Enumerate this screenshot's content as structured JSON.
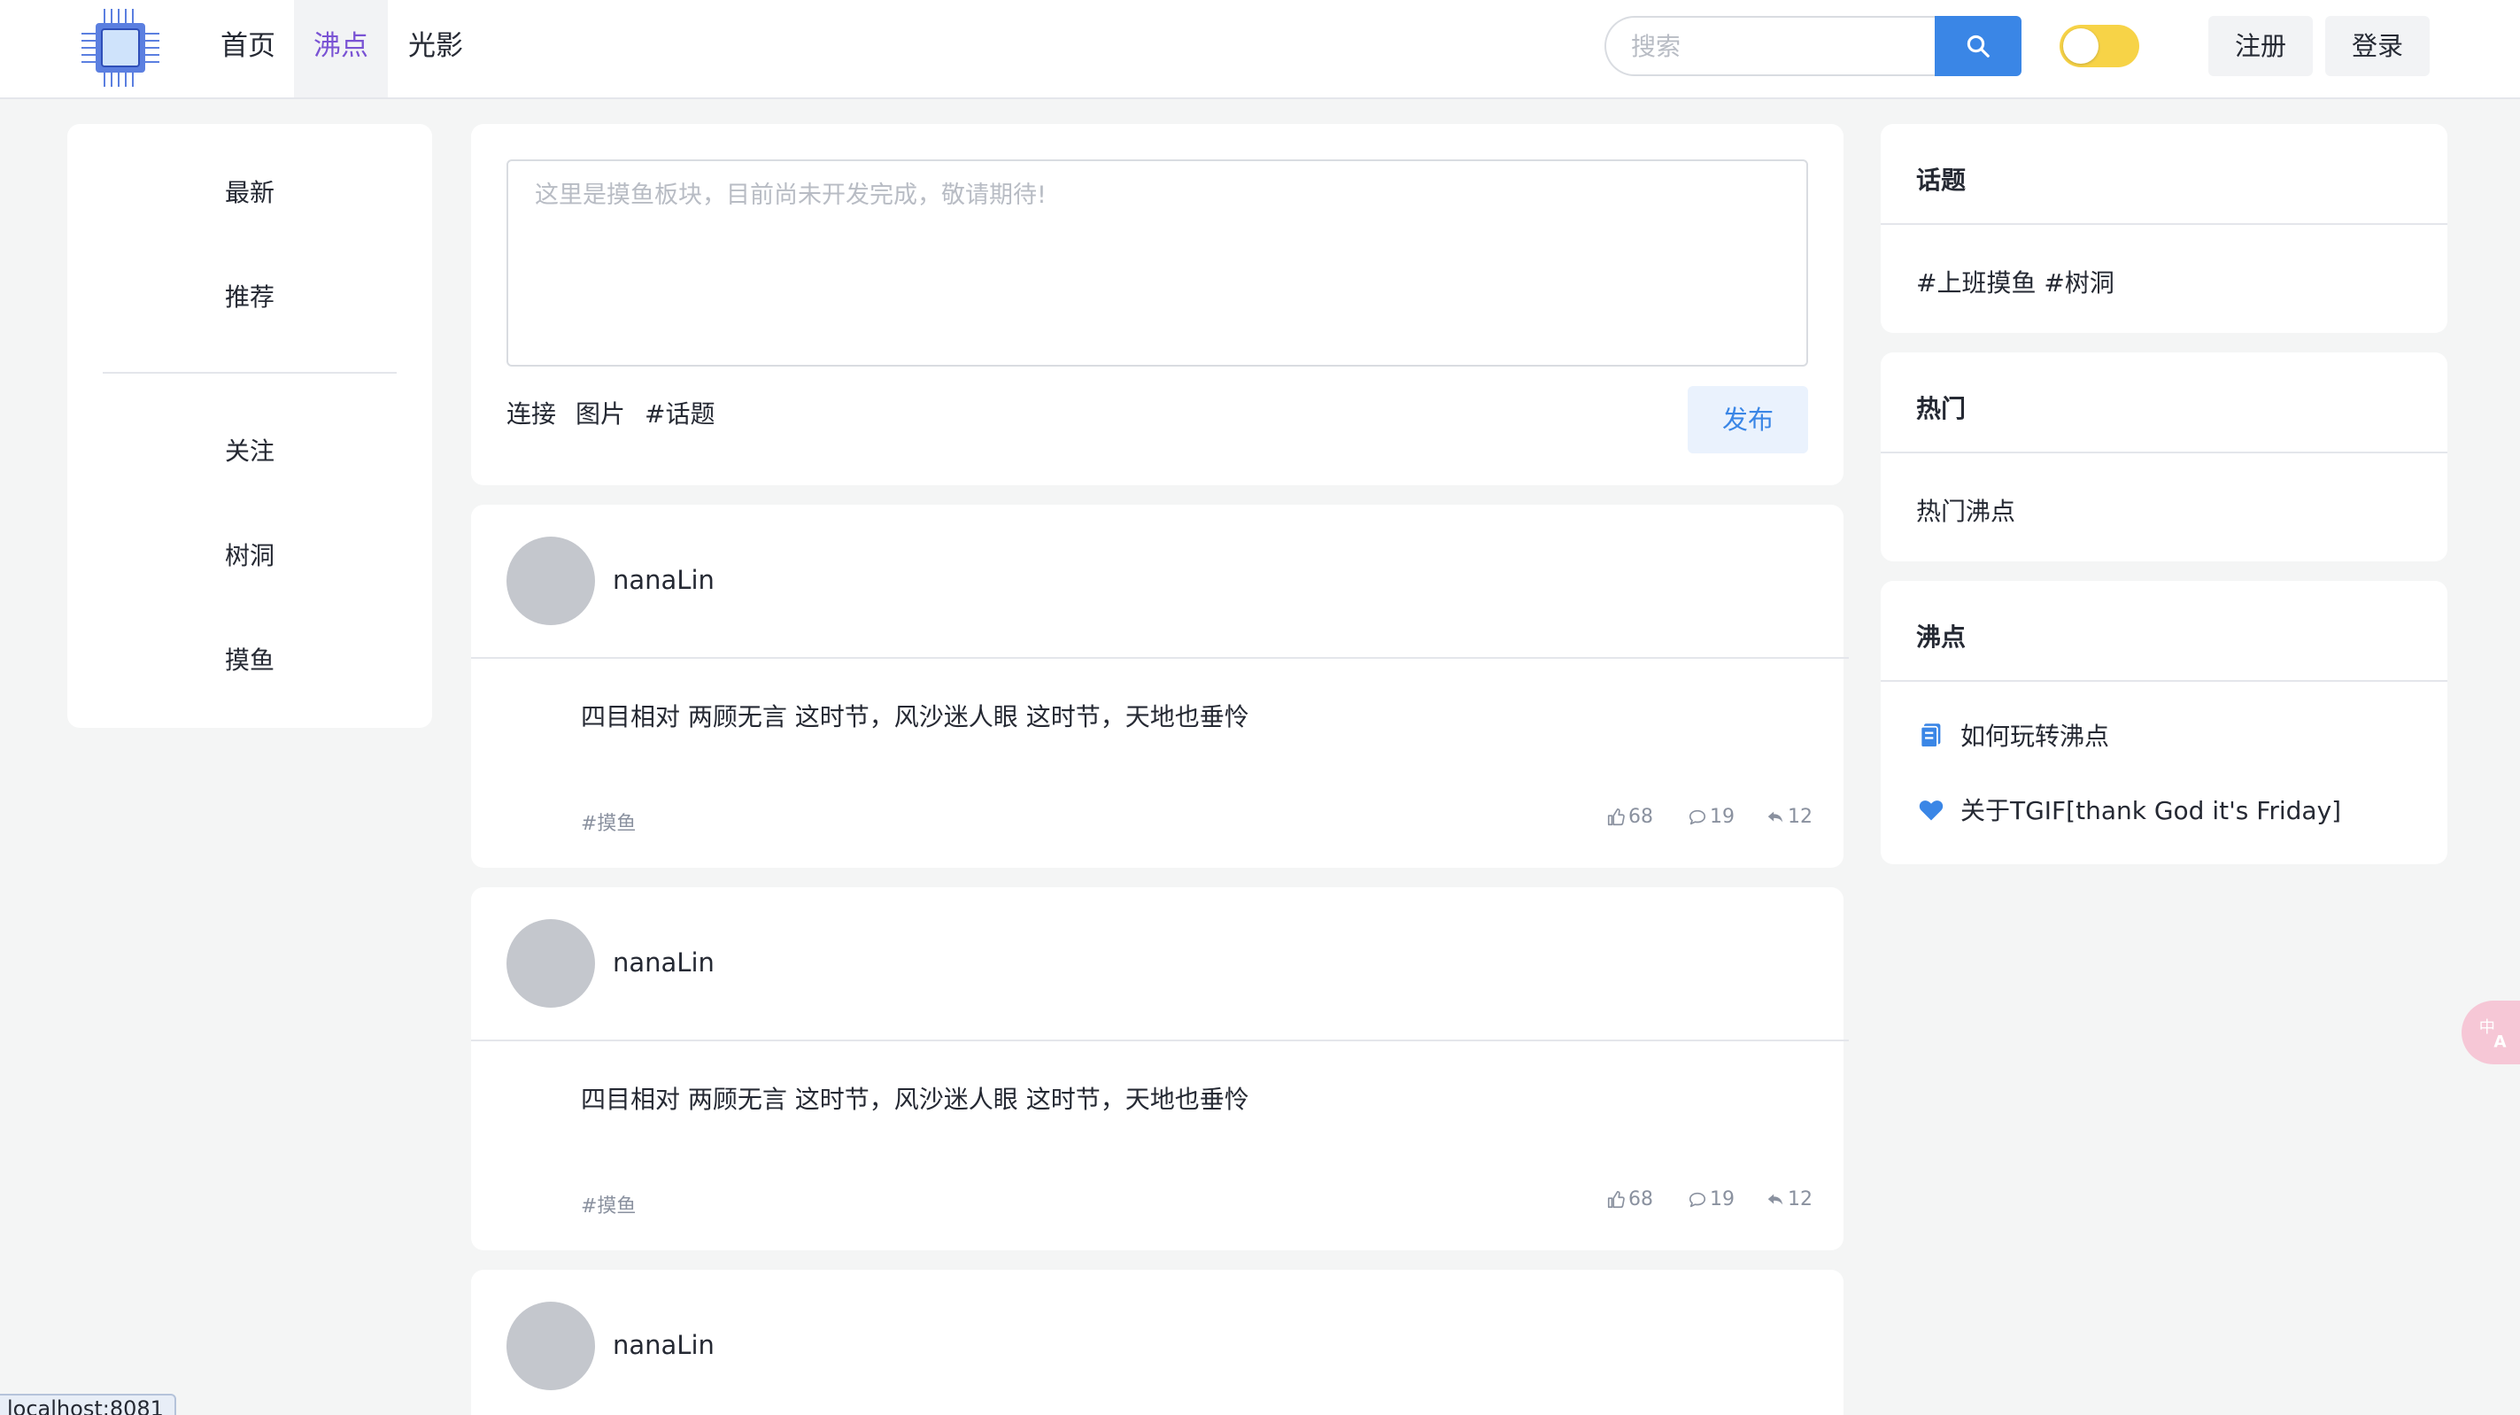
{
  "header": {
    "nav": [
      "首页",
      "沸点",
      "光影"
    ],
    "active_nav": "沸点",
    "search_placeholder": "搜索",
    "register_label": "注册",
    "login_label": "登录"
  },
  "left_menu": {
    "items_top": [
      "最新",
      "推荐"
    ],
    "items_bottom": [
      "关注",
      "树洞",
      "摸鱼"
    ]
  },
  "composer": {
    "placeholder": "这里是摸鱼板块，目前尚未开发完成，敬请期待!",
    "tools": [
      "连接",
      "图片",
      "#话题"
    ],
    "publish_label": "发布"
  },
  "posts": [
    {
      "user": "nanaLin",
      "content": "四目相对 两顾无言 这时节，风沙迷人眼 这时节，天地也垂怜",
      "tag": "#摸鱼",
      "likes": "68",
      "comments": "19",
      "shares": "12"
    },
    {
      "user": "nanaLin",
      "content": "四目相对 两顾无言 这时节，风沙迷人眼 这时节，天地也垂怜",
      "tag": "#摸鱼",
      "likes": "68",
      "comments": "19",
      "shares": "12"
    },
    {
      "user": "nanaLin"
    }
  ],
  "right": {
    "topics": {
      "title": "话题",
      "text": "#上班摸鱼 #树洞"
    },
    "hot": {
      "title": "热门",
      "text": "热门沸点"
    },
    "pins": {
      "title": "沸点",
      "links": [
        {
          "icon": "document-icon",
          "label": "如何玩转沸点"
        },
        {
          "icon": "heart-icon",
          "label": "关于TGIF[thank God it's Friday]"
        }
      ]
    }
  },
  "status_url": "localhost:8081",
  "colors": {
    "accent": "#3a86e6",
    "active_nav": "#7a53d4",
    "toggle": "#f7d347"
  }
}
